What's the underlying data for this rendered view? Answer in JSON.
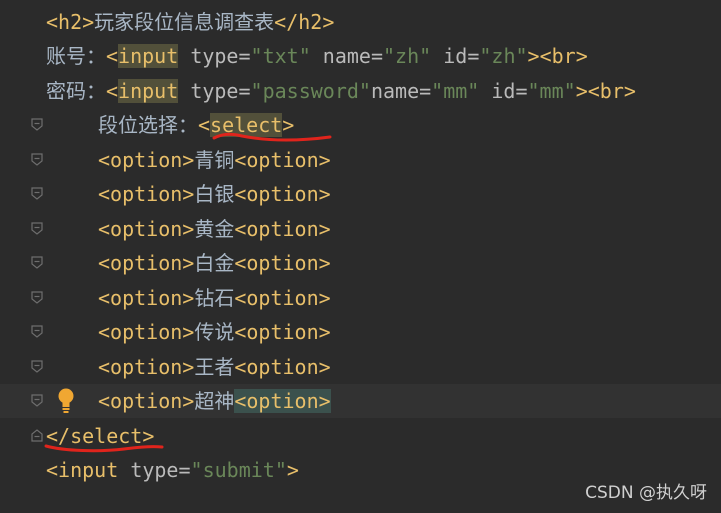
{
  "editor": {
    "lines": [
      {
        "open": "<h2>",
        "text": "玩家段位信息调查表",
        "close": "</h2>"
      },
      {
        "label": "账号：",
        "lt": "<",
        "tag": "input",
        "sp1": " ",
        "a1": "type=",
        "v1": "\"txt\"",
        "sp2": " ",
        "a2": "name=",
        "v2": "\"zh\"",
        "sp3": " ",
        "a3": "id=",
        "v3": "\"zh\"",
        "gt": ">",
        "br": "<br>"
      },
      {
        "label": "密码：",
        "lt": "<",
        "tag": "input",
        "sp1": " ",
        "a1": "type=",
        "v1": "\"password\"",
        "a2": "name=",
        "v2": "\"mm\"",
        "sp3": " ",
        "a3": "id=",
        "v3": "\"mm\"",
        "gt": ">",
        "br": "<br>"
      },
      {
        "label": "段位选择：",
        "lt": "<",
        "tag": "select",
        "gt": ">"
      },
      {
        "open": "<option>",
        "text": "青铜",
        "close": "<option>"
      },
      {
        "open": "<option>",
        "text": "白银",
        "close": "<option>"
      },
      {
        "open": "<option>",
        "text": "黄金",
        "close": "<option>"
      },
      {
        "open": "<option>",
        "text": "白金",
        "close": "<option>"
      },
      {
        "open": "<option>",
        "text": "钻石",
        "close": "<option>"
      },
      {
        "open": "<option>",
        "text": "传说",
        "close": "<option>"
      },
      {
        "open": "<option>",
        "text": "王者",
        "close": "<option>"
      },
      {
        "open": "<option>",
        "text": "超神",
        "close": "<option>"
      },
      {
        "close_tag": "</select>"
      },
      {
        "lt": "<",
        "tag": "input",
        "sp": " ",
        "a1": "type=",
        "v1": "\"submit\"",
        "gt": ">"
      }
    ]
  },
  "watermark": "CSDN @执久呀",
  "icons": {
    "fold": "fold-marker-icon",
    "bulb": "lightbulb-icon",
    "annotation": "red-underline-annotation"
  },
  "colors": {
    "background": "#2b2b2b",
    "tag": "#e8bf6a",
    "string": "#6a8759",
    "text": "#a9b7c6",
    "annotation": "#e0241c"
  }
}
